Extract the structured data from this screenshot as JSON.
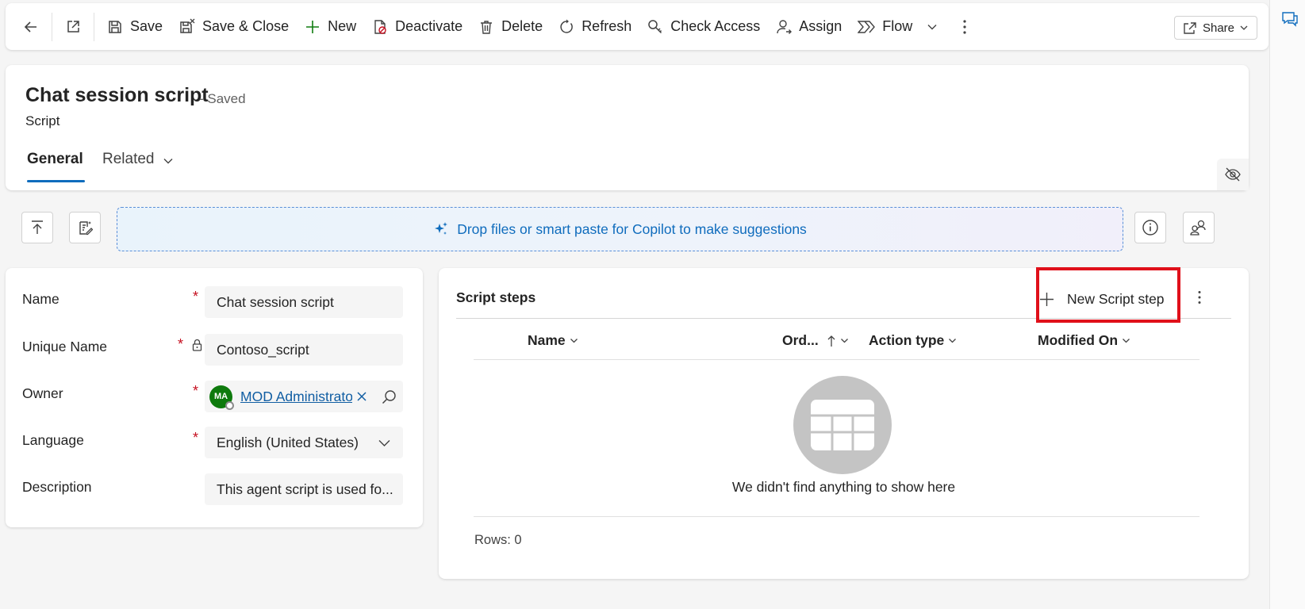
{
  "toolbar": {
    "save": "Save",
    "save_close": "Save & Close",
    "new": "New",
    "deactivate": "Deactivate",
    "delete": "Delete",
    "refresh": "Refresh",
    "check_access": "Check Access",
    "assign": "Assign",
    "flow": "Flow",
    "share": "Share"
  },
  "header": {
    "title": "Chat session script",
    "status": "- Saved",
    "entity": "Script",
    "tabs": [
      "General",
      "Related"
    ]
  },
  "copilot": {
    "dropzone_text": "Drop files or smart paste for Copilot to make suggestions"
  },
  "form": {
    "fields": [
      {
        "label": "Name",
        "value": "Chat session script"
      },
      {
        "label": "Unique Name",
        "value": "Contoso_script"
      },
      {
        "label": "Owner",
        "value": "MOD Administrator",
        "initials": "MA"
      },
      {
        "label": "Language",
        "value": "English (United States)"
      },
      {
        "label": "Description",
        "value": "This agent script is used fo..."
      }
    ]
  },
  "script_steps": {
    "title": "Script steps",
    "new_button": "New Script step",
    "columns": [
      "Name",
      "Ord...",
      "Action type",
      "Modified On"
    ],
    "empty_message": "We didn't find anything to show here",
    "rows_count": "Rows: 0"
  },
  "colors": {
    "accent": "#0f6cbd",
    "highlight": "#e0101a",
    "required": "#c50f1f",
    "avatar": "#0e7a0d"
  },
  "icons": [
    "back-arrow-icon",
    "open-new-window-icon",
    "save-icon",
    "save-close-icon",
    "plus-icon",
    "deactivate-icon",
    "delete-icon",
    "refresh-icon",
    "check-access-icon",
    "assign-icon",
    "flow-icon",
    "chevron-down-icon",
    "more-icon",
    "share-icon",
    "chat-icon",
    "hide-icon",
    "move-top-icon",
    "form-fill-icon",
    "sparkle-icon",
    "info-icon",
    "people-icon",
    "lock-icon",
    "search-icon",
    "close-icon",
    "sort-ascending-icon",
    "grid-icon"
  ]
}
